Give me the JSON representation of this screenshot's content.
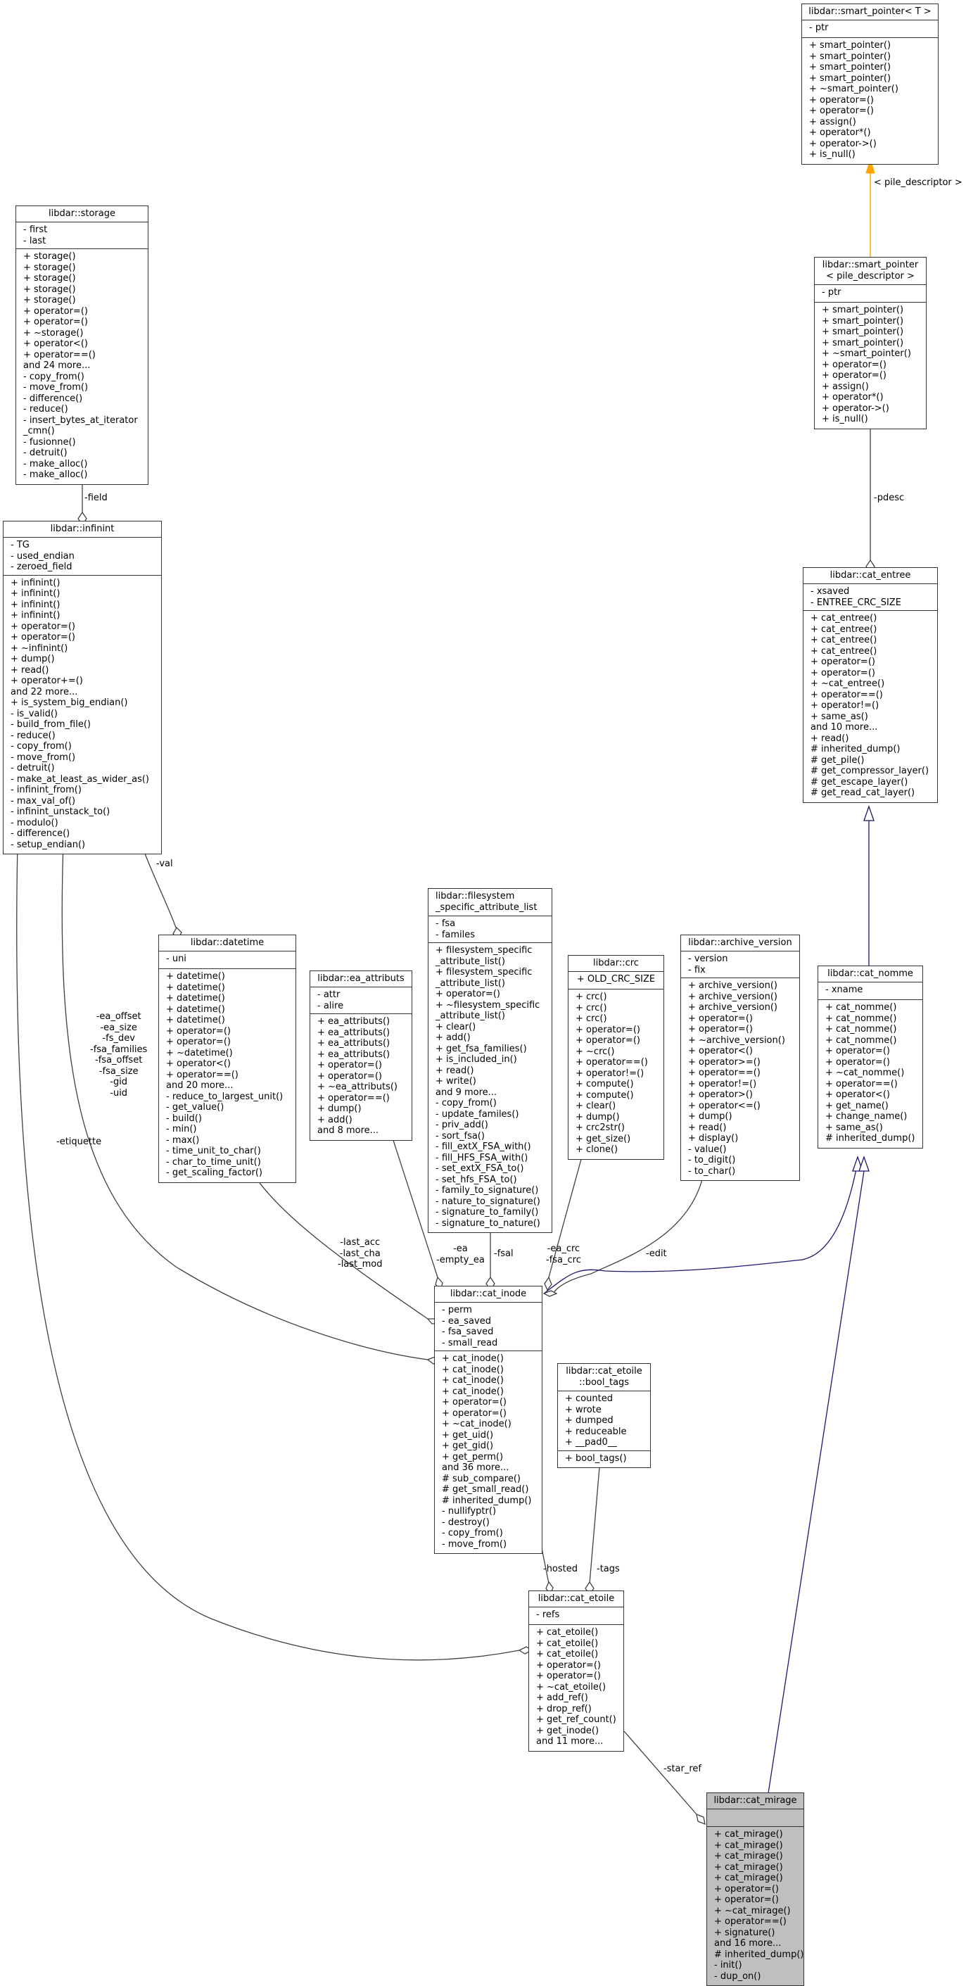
{
  "classes": {
    "smart_pointer_T": {
      "title": "libdar::smart_pointer< T >",
      "attributes": [
        "- ptr"
      ],
      "methods": [
        "+ smart_pointer()",
        "+ smart_pointer()",
        "+ smart_pointer()",
        "+ smart_pointer()",
        "+ ~smart_pointer()",
        "+ operator=()",
        "+ operator=()",
        "+ assign()",
        "+ operator*()",
        "+ operator->()",
        "+ is_null()"
      ]
    },
    "smart_pointer_pd": {
      "title": "libdar::smart_pointer\n< pile_descriptor >",
      "attributes": [
        "- ptr"
      ],
      "methods": [
        "+ smart_pointer()",
        "+ smart_pointer()",
        "+ smart_pointer()",
        "+ smart_pointer()",
        "+ ~smart_pointer()",
        "+ operator=()",
        "+ operator=()",
        "+ assign()",
        "+ operator*()",
        "+ operator->()",
        "+ is_null()"
      ]
    },
    "storage": {
      "title": "libdar::storage",
      "attributes": [
        "- first",
        "- last"
      ],
      "methods": [
        "+ storage()",
        "+ storage()",
        "+ storage()",
        "+ storage()",
        "+ storage()",
        "+ operator=()",
        "+ operator=()",
        "+ ~storage()",
        "+ operator<()",
        "+ operator==()",
        "and 24 more...",
        "- copy_from()",
        "- move_from()",
        "- difference()",
        "- reduce()",
        "- insert_bytes_at_iterator\n_cmn()",
        "- fusionne()",
        "- detruit()",
        "- make_alloc()",
        "- make_alloc()"
      ]
    },
    "infinint": {
      "title": "libdar::infinint",
      "attributes": [
        "- TG",
        "- used_endian",
        "- zeroed_field"
      ],
      "methods": [
        "+ infinint()",
        "+ infinint()",
        "+ infinint()",
        "+ infinint()",
        "+ operator=()",
        "+ operator=()",
        "+ ~infinint()",
        "+ dump()",
        "+ read()",
        "+ operator+=()",
        "and 22 more...",
        "+ is_system_big_endian()",
        "- is_valid()",
        "- build_from_file()",
        "- reduce()",
        "- copy_from()",
        "- move_from()",
        "- detruit()",
        "- make_at_least_as_wider_as()",
        "- infinint_from()",
        "- max_val_of()",
        "- infinint_unstack_to()",
        "- modulo()",
        "- difference()",
        "- setup_endian()"
      ]
    },
    "cat_entree": {
      "title": "libdar::cat_entree",
      "attributes": [
        "- xsaved",
        "- ENTREE_CRC_SIZE"
      ],
      "methods": [
        "+ cat_entree()",
        "+ cat_entree()",
        "+ cat_entree()",
        "+ cat_entree()",
        "+ operator=()",
        "+ operator=()",
        "+ ~cat_entree()",
        "+ operator==()",
        "+ operator!=()",
        "+ same_as()",
        "and 10 more...",
        "+ read()",
        "# inherited_dump()",
        "# get_pile()",
        "# get_compressor_layer()",
        "# get_escape_layer()",
        "# get_read_cat_layer()"
      ]
    },
    "datetime": {
      "title": "libdar::datetime",
      "attributes": [
        "- uni"
      ],
      "methods": [
        "+ datetime()",
        "+ datetime()",
        "+ datetime()",
        "+ datetime()",
        "+ datetime()",
        "+ operator=()",
        "+ operator=()",
        "+ ~datetime()",
        "+ operator<()",
        "+ operator==()",
        "and 20 more...",
        "- reduce_to_largest_unit()",
        "- get_value()",
        "- build()",
        "- min()",
        "- max()",
        "- time_unit_to_char()",
        "- char_to_time_unit()",
        "- get_scaling_factor()"
      ]
    },
    "ea_attributs": {
      "title": "libdar::ea_attributs",
      "attributes": [
        "- attr",
        "- alire"
      ],
      "methods": [
        "+ ea_attributs()",
        "+ ea_attributs()",
        "+ ea_attributs()",
        "+ ea_attributs()",
        "+ operator=()",
        "+ operator=()",
        "+ ~ea_attributs()",
        "+ operator==()",
        "+ dump()",
        "+ add()",
        "and 8 more..."
      ]
    },
    "fsal": {
      "title": "libdar::filesystem\n_specific_attribute_list",
      "attributes": [
        "- fsa",
        "- familes"
      ],
      "methods": [
        "+ filesystem_specific\n_attribute_list()",
        "+ filesystem_specific\n_attribute_list()",
        "+ operator=()",
        "+ ~filesystem_specific\n_attribute_list()",
        "+ clear()",
        "+ add()",
        "+ get_fsa_families()",
        "+ is_included_in()",
        "+ read()",
        "+ write()",
        "and 9 more...",
        "- copy_from()",
        "- update_familes()",
        "- priv_add()",
        "- sort_fsa()",
        "- fill_extX_FSA_with()",
        "- fill_HFS_FSA_with()",
        "- set_extX_FSA_to()",
        "- set_hfs_FSA_to()",
        "- family_to_signature()",
        "- nature_to_signature()",
        "- signature_to_family()",
        "- signature_to_nature()"
      ]
    },
    "crc": {
      "title": "libdar::crc",
      "attributes": [
        "+ OLD_CRC_SIZE"
      ],
      "methods": [
        "+ crc()",
        "+ crc()",
        "+ crc()",
        "+ operator=()",
        "+ operator=()",
        "+ ~crc()",
        "+ operator==()",
        "+ operator!=()",
        "+ compute()",
        "+ compute()",
        "+ clear()",
        "+ dump()",
        "+ crc2str()",
        "+ get_size()",
        "+ clone()"
      ]
    },
    "archive_version": {
      "title": "libdar::archive_version",
      "attributes": [
        "- version",
        "- fix"
      ],
      "methods": [
        "+ archive_version()",
        "+ archive_version()",
        "+ archive_version()",
        "+ operator=()",
        "+ operator=()",
        "+ ~archive_version()",
        "+ operator<()",
        "+ operator>=()",
        "+ operator==()",
        "+ operator!=()",
        "+ operator>()",
        "+ operator<=()",
        "+ dump()",
        "+ read()",
        "+ display()",
        "- value()",
        "- to_digit()",
        "- to_char()"
      ]
    },
    "cat_nomme": {
      "title": "libdar::cat_nomme",
      "attributes": [
        "- xname"
      ],
      "methods": [
        "+ cat_nomme()",
        "+ cat_nomme()",
        "+ cat_nomme()",
        "+ cat_nomme()",
        "+ operator=()",
        "+ operator=()",
        "+ ~cat_nomme()",
        "+ operator==()",
        "+ operator<()",
        "+ get_name()",
        "+ change_name()",
        "+ same_as()",
        "# inherited_dump()"
      ]
    },
    "cat_inode": {
      "title": "libdar::cat_inode",
      "attributes": [
        "- perm",
        "- ea_saved",
        "- fsa_saved",
        "- small_read"
      ],
      "methods": [
        "+ cat_inode()",
        "+ cat_inode()",
        "+ cat_inode()",
        "+ cat_inode()",
        "+ operator=()",
        "+ operator=()",
        "+ ~cat_inode()",
        "+ get_uid()",
        "+ get_gid()",
        "+ get_perm()",
        "and 36 more...",
        "# sub_compare()",
        "# get_small_read()",
        "# inherited_dump()",
        "- nullifyptr()",
        "- destroy()",
        "- copy_from()",
        "- move_from()"
      ]
    },
    "bool_tags": {
      "title": "libdar::cat_etoile\n::bool_tags",
      "attributes": [
        "+ counted",
        "+ wrote",
        "+ dumped",
        "+ reduceable",
        "+ __pad0__"
      ],
      "methods": [
        "+ bool_tags()"
      ]
    },
    "cat_etoile": {
      "title": "libdar::cat_etoile",
      "attributes": [
        "- refs"
      ],
      "methods": [
        "+ cat_etoile()",
        "+ cat_etoile()",
        "+ cat_etoile()",
        "+ operator=()",
        "+ operator=()",
        "+ ~cat_etoile()",
        "+ add_ref()",
        "+ drop_ref()",
        "+ get_ref_count()",
        "+ get_inode()",
        "and 11 more..."
      ]
    },
    "cat_mirage": {
      "title": "libdar::cat_mirage",
      "attributes": [],
      "methods": [
        "+ cat_mirage()",
        "+ cat_mirage()",
        "+ cat_mirage()",
        "+ cat_mirage()",
        "+ cat_mirage()",
        "+ operator=()",
        "+ operator=()",
        "+ ~cat_mirage()",
        "+ operator==()",
        "+ signature()",
        "and 16 more...",
        "# inherited_dump()",
        "- init()",
        "- dup_on()"
      ]
    }
  },
  "edge_labels": {
    "template_arg": "< pile_descriptor >",
    "pdesc": "-pdesc",
    "field": "-field",
    "val": "-val",
    "infinint_to_inode": "-ea_offset\n-ea_size\n-fs_dev\n-fsa_families\n-fsa_offset\n-fsa_size\n-gid\n-uid",
    "etiquette": "-etiquette",
    "datetime_to_inode": "-last_acc\n-last_cha\n-last_mod",
    "ea": "-ea\n-empty_ea",
    "fsal": "-fsal",
    "crc": "-ea_crc\n-fsa_crc",
    "edit": "-edit",
    "hosted": "-hosted",
    "tags": "-tags",
    "star_ref": "-star_ref"
  },
  "colors": {
    "inheritance": "#191970",
    "template": "#ffa500",
    "association": "#404040",
    "focus_fill": "#bfbfbf"
  }
}
